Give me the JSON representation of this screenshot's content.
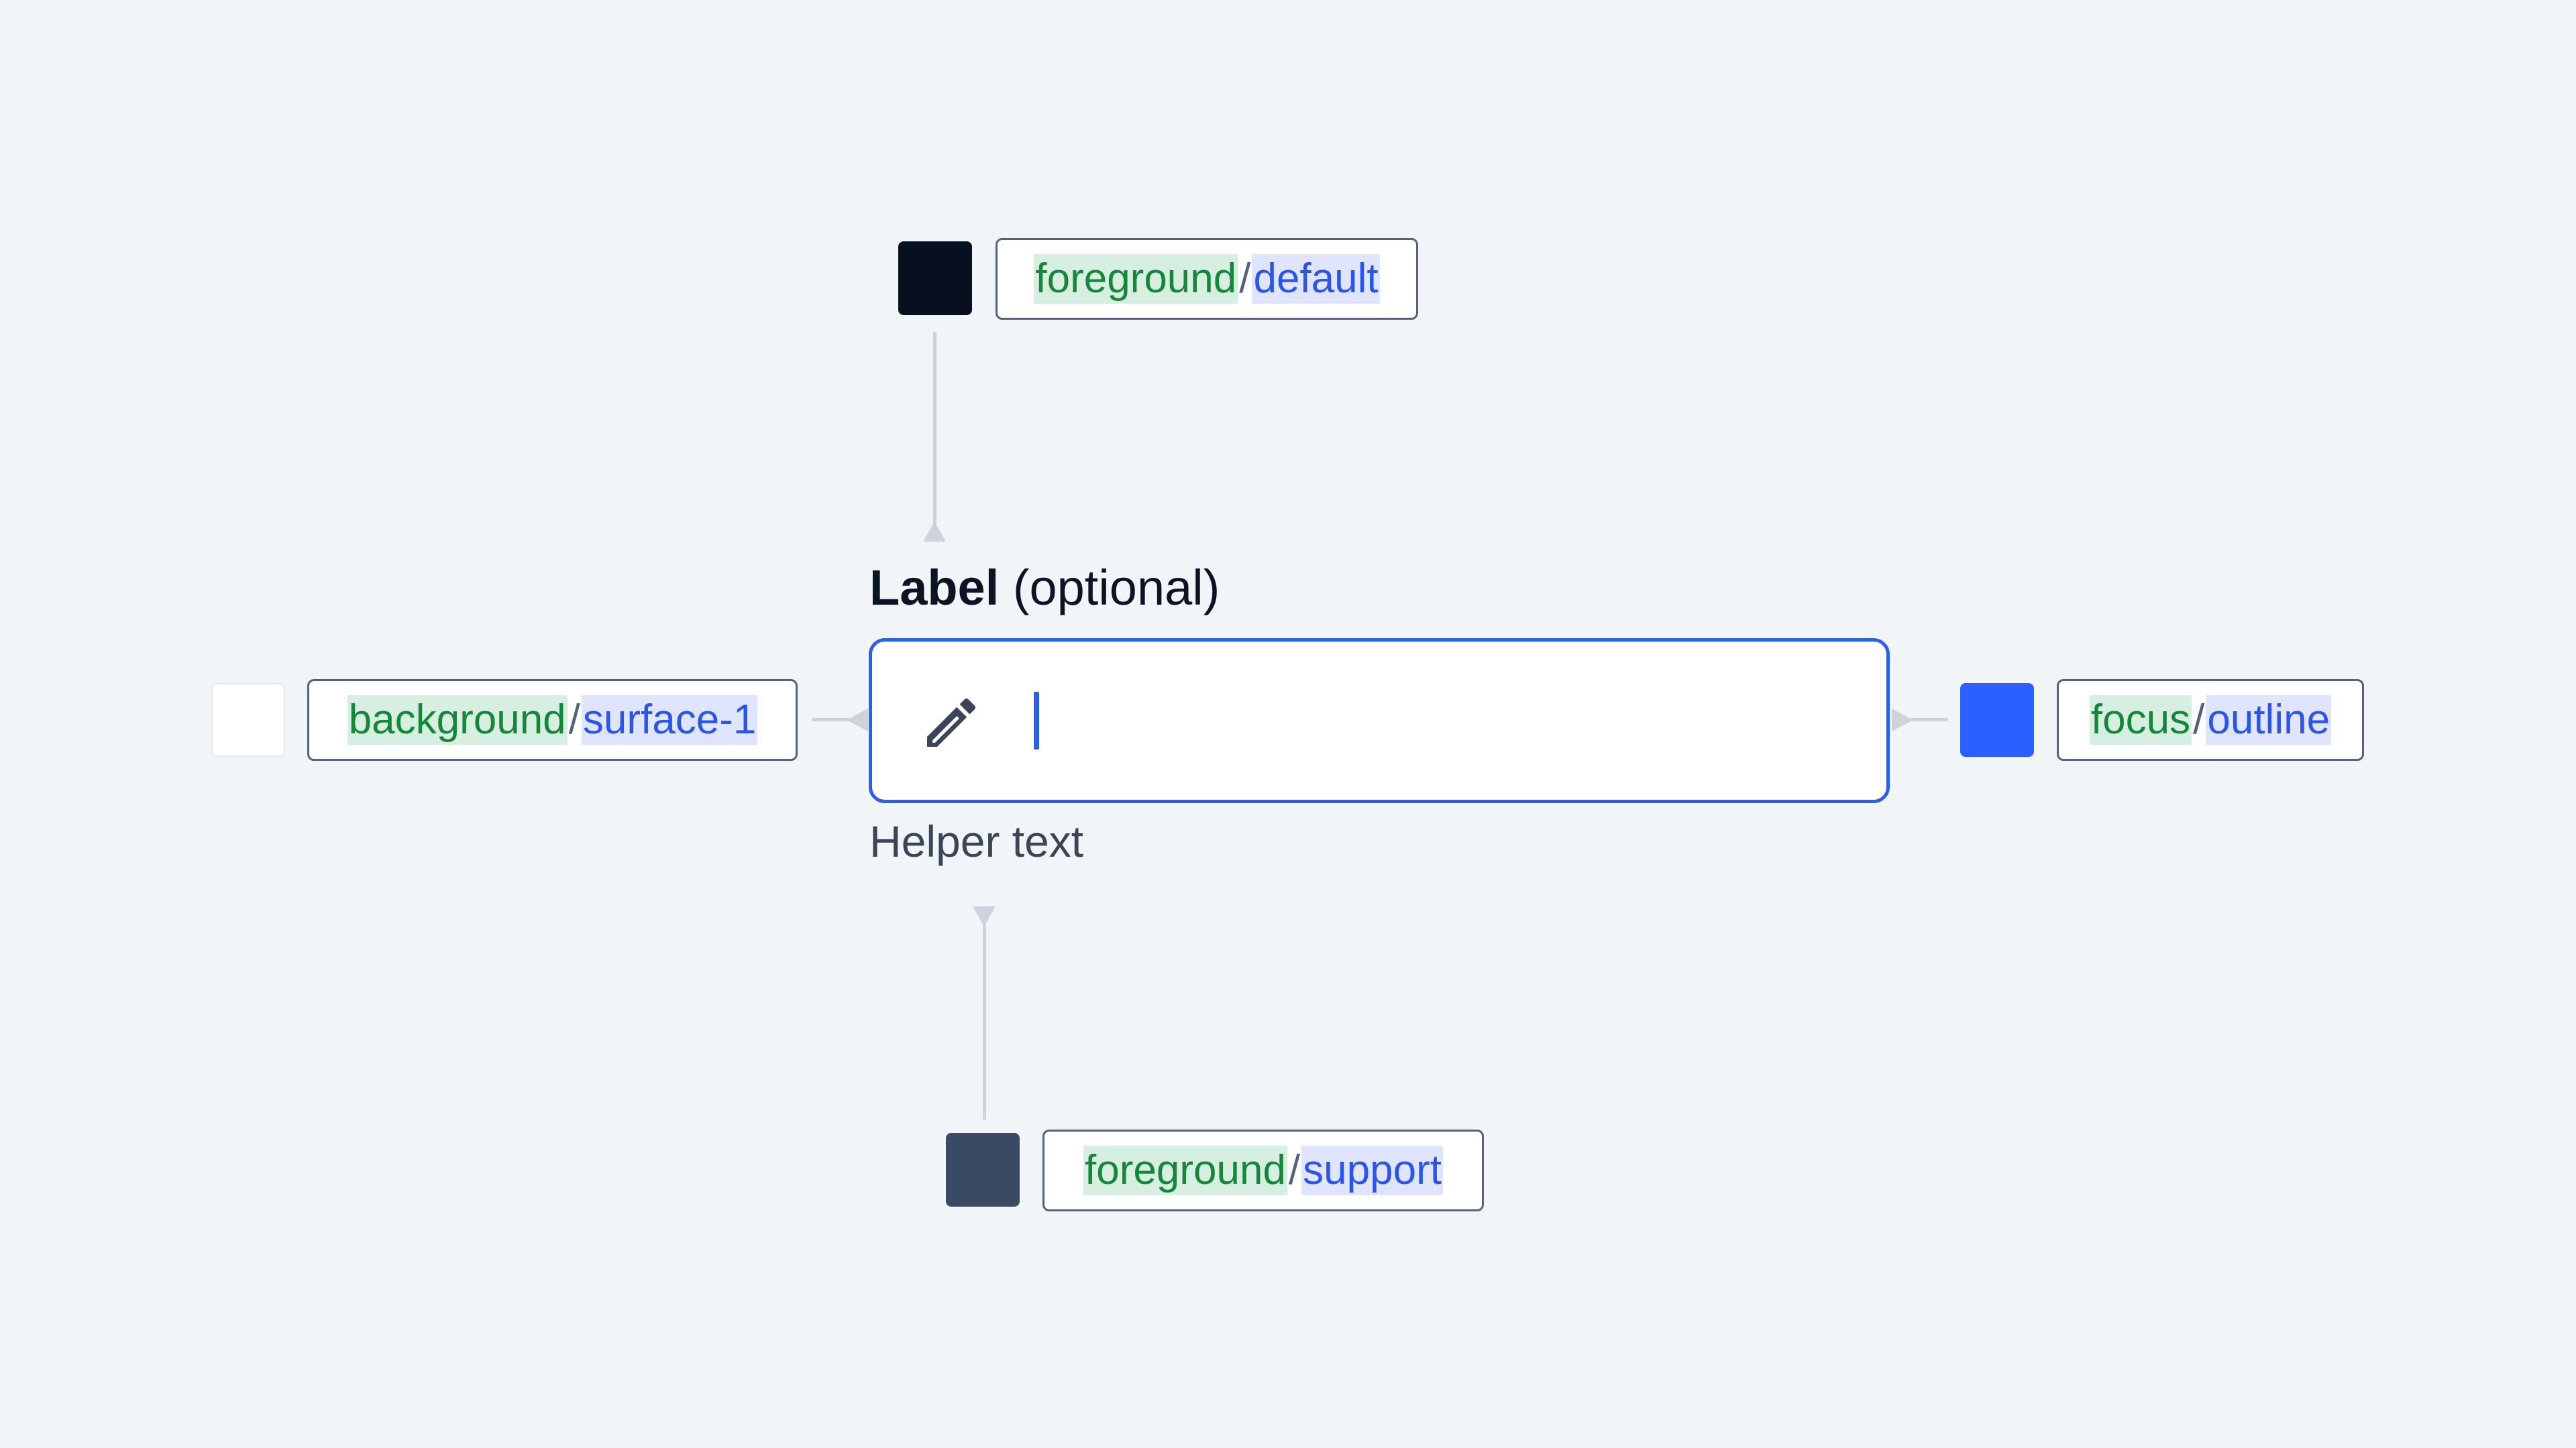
{
  "field": {
    "label": "Label",
    "label_suffix": "(optional)",
    "helper_text": "Helper text",
    "icon": "pencil-icon"
  },
  "tokens": {
    "top": {
      "category": "foreground",
      "separator": "/",
      "token": "default",
      "swatch_color": "#06101f"
    },
    "left": {
      "category": "background",
      "separator": "/",
      "token": "surface-1",
      "swatch_color": "#ffffff"
    },
    "right": {
      "category": "focus",
      "separator": "/",
      "token": "outline",
      "swatch_color": "#2b5fff"
    },
    "bottom": {
      "category": "foreground",
      "separator": "/",
      "token": "support",
      "swatch_color": "#3b4a63"
    }
  },
  "colors": {
    "background": "#f2f5f8",
    "category_text": "#16863a",
    "category_highlight": "#d6efe0",
    "token_text": "#2b55e6",
    "token_highlight": "#dfe4ff",
    "connector": "#cdd3dd",
    "focus_border": "#2b5fe8"
  }
}
